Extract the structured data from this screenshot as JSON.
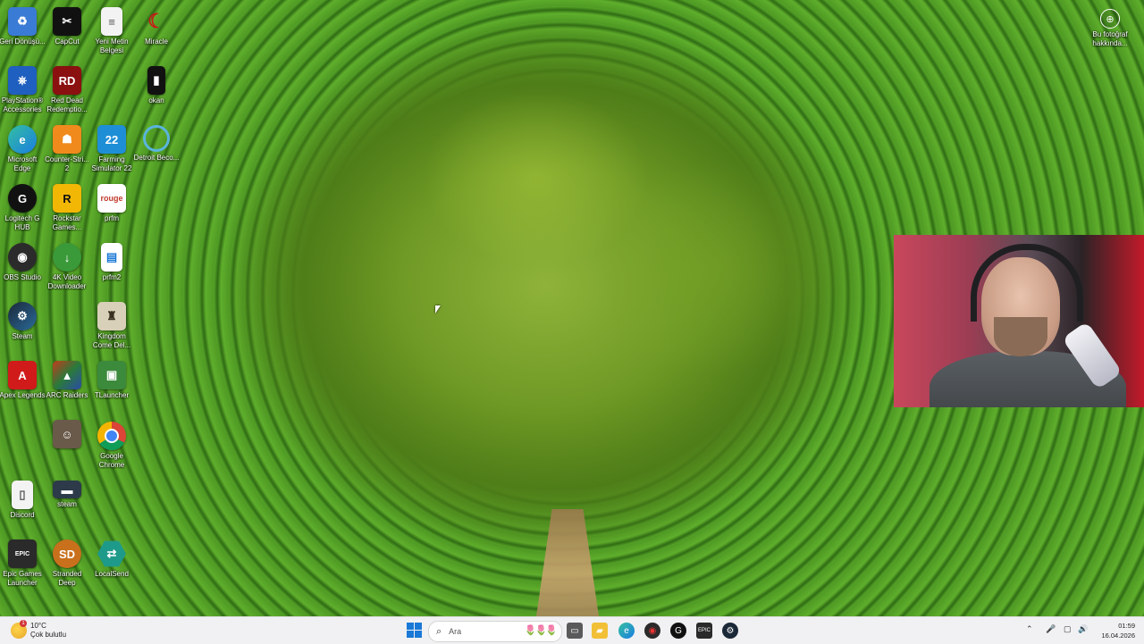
{
  "desktop": {
    "icons": [
      {
        "label": "Geri Dönüşü...",
        "icon": "recycle-bin-icon",
        "color": "#3a7bd5"
      },
      {
        "label": "PlayStation® Accessories",
        "icon": "playstation-icon",
        "color": "#1f5fbf"
      },
      {
        "label": "Microsoft Edge",
        "icon": "edge-icon",
        "color": "#1b9de2"
      },
      {
        "label": "Logitech G HUB",
        "icon": "logitech-icon",
        "color": "#111111"
      },
      {
        "label": "OBS Studio",
        "icon": "obs-icon",
        "color": "#2b2b2b"
      },
      {
        "label": "Steam",
        "icon": "steam-icon",
        "color": "#1b2838"
      },
      {
        "label": "Apex Legends",
        "icon": "apex-icon",
        "color": "#d11a1a"
      },
      {
        "label": "Epic Games Launcher",
        "icon": "epic-games-icon",
        "color": "#2a2a2a"
      },
      {
        "label": "CapCut",
        "icon": "capcut-icon",
        "color": "#111111"
      },
      {
        "label": "Red Dead Redemptio...",
        "icon": "red-dead-icon",
        "color": "#8b1010"
      },
      {
        "label": "Counter-Stri... 2",
        "icon": "counter-strike-icon",
        "color": "#f08a1c"
      },
      {
        "label": "Rockstar Games...",
        "icon": "rockstar-icon",
        "color": "#f2b705"
      },
      {
        "label": "4K Video Downloader",
        "icon": "video-downloader-icon",
        "color": "#3a9a3a"
      },
      {
        "label": "ARC Raiders",
        "icon": "arc-raiders-icon",
        "color": "#c43c1c"
      },
      {
        "label": "",
        "icon": "person-photo-icon",
        "color": "#6a5a4a"
      },
      {
        "label": "Stranded Deep",
        "icon": "stranded-deep-icon",
        "color": "#c8701c"
      },
      {
        "label": "Yeni Metin Belgesi",
        "icon": "text-file-icon",
        "color": "#f3f3f3"
      },
      {
        "label": "Farming Simulator 22",
        "icon": "farming-simulator-icon",
        "color": "#1e8fd6"
      },
      {
        "label": "prfm",
        "icon": "prfm-icon",
        "color": "#ffffff"
      },
      {
        "label": "prfm2",
        "icon": "document-icon",
        "color": "#ffffff"
      },
      {
        "label": "Kingdom Come Del...",
        "icon": "kingdom-come-icon",
        "color": "#d8d0b8"
      },
      {
        "label": "TLauncher",
        "icon": "tlauncher-icon",
        "color": "#3c8a3c"
      },
      {
        "label": "Google Chrome",
        "icon": "chrome-icon",
        "color": "#ffffff"
      },
      {
        "label": "Discord",
        "icon": "discord-file-icon",
        "color": "#f3f3f3"
      },
      {
        "label": "Miracle",
        "icon": "miracle-icon",
        "color": "#c81818"
      },
      {
        "label": "okan",
        "icon": "phone-icon",
        "color": "#111111"
      },
      {
        "label": "Detroit Beco...",
        "icon": "detroit-icon",
        "color": "#5ab4dc"
      },
      {
        "label": "steam",
        "icon": "steam-shortcut-icon",
        "color": "#2c3a4a"
      },
      {
        "label": "LocalSend",
        "icon": "localsend-icon",
        "color": "#1e9a8a"
      }
    ],
    "about_photo": {
      "label": "Bu fotoğraf hakkında..."
    }
  },
  "taskbar": {
    "weather": {
      "temp": "10°C",
      "desc": "Çok bulutlu",
      "badge": "1"
    },
    "search_placeholder": "Ara",
    "time": "01:59",
    "date": "16.04.2026",
    "accent": "#1a78d6"
  }
}
